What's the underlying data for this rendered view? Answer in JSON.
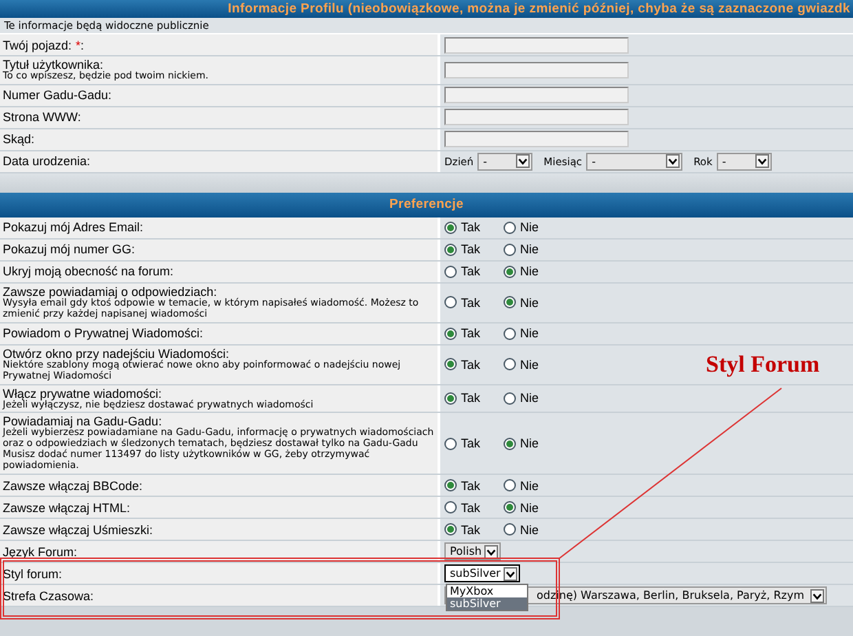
{
  "profile": {
    "title": "Informacje Profilu (nieobowiązkowe, można je zmienić później, chyba że są zaznaczone gwiazdk",
    "note": "Te informacje będą widoczne publicznie",
    "rows": [
      {
        "kind": "text",
        "label": "Twój pojazd:",
        "required_mark": "*",
        "label_end": ":"
      },
      {
        "kind": "text",
        "label": "Tytuł użytkownika:",
        "description": "To co wpiszesz, będzie pod twoim nickiem."
      },
      {
        "kind": "text",
        "label": "Numer Gadu-Gadu:"
      },
      {
        "kind": "text",
        "label": "Strona WWW:"
      },
      {
        "kind": "text",
        "label": "Skąd:"
      },
      {
        "kind": "date",
        "label": "Data urodzenia:",
        "parts": [
          {
            "label": "Dzień",
            "value": "-"
          },
          {
            "label": "Miesiąc",
            "value": "-"
          },
          {
            "label": "Rok",
            "value": "-"
          }
        ]
      }
    ]
  },
  "preferences": {
    "title": "Preferencje",
    "rows": [
      {
        "kind": "choice",
        "label": "Pokazuj mój Adres Email:",
        "options": [
          {
            "label": "Tak",
            "selected": true
          },
          {
            "label": "Nie",
            "selected": false
          }
        ]
      },
      {
        "kind": "choice",
        "label": "Pokazuj mój numer GG:",
        "options": [
          {
            "label": "Tak",
            "selected": true
          },
          {
            "label": "Nie",
            "selected": false
          }
        ]
      },
      {
        "kind": "choice",
        "label": "Ukryj moją obecność na forum:",
        "options": [
          {
            "label": "Tak",
            "selected": false
          },
          {
            "label": "Nie",
            "selected": true
          }
        ]
      },
      {
        "kind": "choice",
        "label": "Zawsze powiadamiaj o odpowiedziach:",
        "description": "Wysyła email gdy ktoś odpowie w temacie, w którym napisałeś wiadomość. Możesz to zmienić przy każdej napisanej wiadomości",
        "options": [
          {
            "label": "Tak",
            "selected": false
          },
          {
            "label": "Nie",
            "selected": true
          }
        ]
      },
      {
        "kind": "choice",
        "label": "Powiadom o Prywatnej Wiadomości:",
        "options": [
          {
            "label": "Tak",
            "selected": true
          },
          {
            "label": "Nie",
            "selected": false
          }
        ]
      },
      {
        "kind": "choice",
        "label": "Otwórz okno przy nadejściu Wiadomości:",
        "description": "Niektóre szablony mogą otwierać nowe okno aby poinformować o nadejściu nowej Prywatnej Wiadomości",
        "options": [
          {
            "label": "Tak",
            "selected": true
          },
          {
            "label": "Nie",
            "selected": false
          }
        ]
      },
      {
        "kind": "choice",
        "label": "Włącz prywatne wiadomości:",
        "description": "Jeżeli wyłączysz, nie będziesz dostawać prywatnych wiadomości",
        "options": [
          {
            "label": "Tak",
            "selected": true
          },
          {
            "label": "Nie",
            "selected": false
          }
        ]
      },
      {
        "kind": "choice",
        "label": "Powiadamiaj na Gadu-Gadu:",
        "description": "Jeżeli wybierzesz powiadamiane na Gadu-Gadu, informację o prywatnych wiadomościach oraz o odpowiedziach w śledzonych tematach, będziesz dostawał tylko na Gadu-Gadu",
        "extra": "Musisz dodać numer 113497 do listy użytkowników w GG, żeby otrzymywać powiadomienia.",
        "options": [
          {
            "label": "Tak",
            "selected": false
          },
          {
            "label": "Nie",
            "selected": true
          }
        ]
      },
      {
        "kind": "choice",
        "label": "Zawsze włączaj BBCode:",
        "options": [
          {
            "label": "Tak",
            "selected": true
          },
          {
            "label": "Nie",
            "selected": false
          }
        ]
      },
      {
        "kind": "choice",
        "label": "Zawsze włączaj HTML:",
        "options": [
          {
            "label": "Tak",
            "selected": false
          },
          {
            "label": "Nie",
            "selected": true
          }
        ]
      },
      {
        "kind": "choice",
        "label": "Zawsze włączaj Uśmieszki:",
        "options": [
          {
            "label": "Tak",
            "selected": true
          },
          {
            "label": "Nie",
            "selected": false
          }
        ]
      },
      {
        "kind": "select",
        "label": "Język Forum:",
        "value": "Polish"
      },
      {
        "kind": "select",
        "label": "Styl forum:",
        "value": "subSilver",
        "expanded": true,
        "options": [
          {
            "label": "MyXbox",
            "selected": false
          },
          {
            "label": "subSilver",
            "selected": true
          }
        ]
      },
      {
        "kind": "wide-select",
        "label": "Strefa Czasowa:",
        "value": "odzinę) Warszawa, Berlin, Bruksela, Paryż, Rzym"
      }
    ]
  },
  "annotation": {
    "label": "Styl Forum"
  }
}
